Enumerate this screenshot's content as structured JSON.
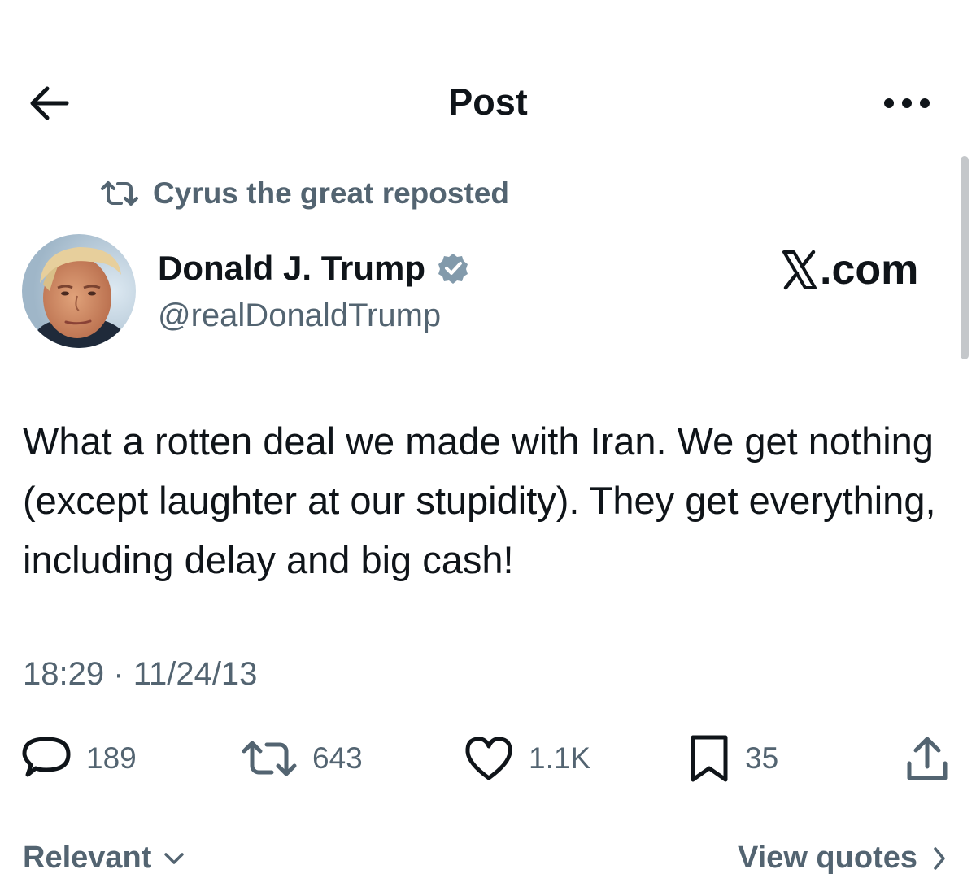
{
  "header": {
    "title": "Post",
    "back_icon": "arrow-left-icon",
    "more_icon": "more-dots-icon"
  },
  "repost": {
    "icon": "repost-icon",
    "label": "Cyrus the great reposted"
  },
  "author": {
    "name": "Donald J. Trump",
    "handle": "@realDonaldTrump",
    "verified_icon": "verified-badge-icon",
    "avatar": "avatar-photo"
  },
  "watermark": {
    "logo_letter": "X",
    "suffix": ".com"
  },
  "tweet": {
    "text": "What a rotten deal we made with Iran. We get nothing (except laughter at our stupidity). They get everything, including delay and big cash!"
  },
  "meta": {
    "time": "18:29",
    "separator": "·",
    "date": "11/24/13"
  },
  "actions": {
    "replies": "189",
    "reposts": "643",
    "likes": "1.1K",
    "bookmarks": "35",
    "share_icon": "share-icon"
  },
  "footer": {
    "sort_label": "Relevant",
    "quotes_label": "View quotes"
  },
  "colors": {
    "text_primary": "#0f1419",
    "text_secondary": "#536471",
    "verified_badge": "#829aab",
    "scrollbar": "#c4c7ca",
    "background": "#ffffff"
  }
}
